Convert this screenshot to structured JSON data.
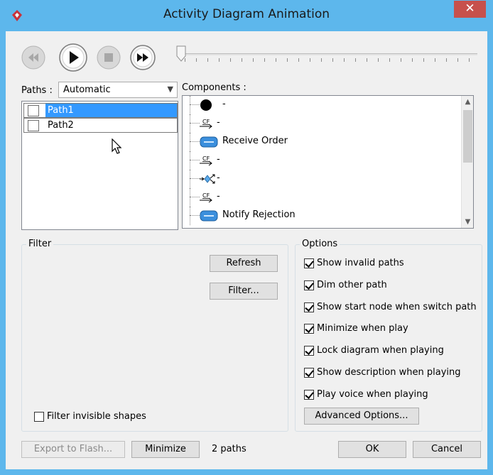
{
  "window": {
    "title": "Activity Diagram Animation",
    "close_label": "✕"
  },
  "paths": {
    "label": "Paths :",
    "selected_option": "Automatic",
    "items": [
      {
        "label": "Path1",
        "checked": false,
        "selected": true
      },
      {
        "label": "Path2",
        "checked": false,
        "selected": false
      }
    ]
  },
  "components": {
    "label": "Components :",
    "items": [
      {
        "icon": "initial-node-icon",
        "label": "-"
      },
      {
        "icon": "control-flow-icon",
        "label": "-"
      },
      {
        "icon": "action-icon",
        "label": "Receive Order"
      },
      {
        "icon": "control-flow-icon",
        "label": "-"
      },
      {
        "icon": "decision-node-icon",
        "label": "-"
      },
      {
        "icon": "control-flow-icon",
        "label": "-"
      },
      {
        "icon": "action-icon",
        "label": "Notify Rejection"
      }
    ],
    "flow_icon_text": "CF"
  },
  "filter": {
    "title": "Filter",
    "refresh_label": "Refresh",
    "filter_label": "Filter...",
    "invisible_shapes_label": "Filter invisible shapes",
    "invisible_shapes_checked": false
  },
  "options": {
    "title": "Options",
    "items": [
      {
        "label": "Show invalid paths",
        "checked": true
      },
      {
        "label": "Dim other path",
        "checked": true
      },
      {
        "label": "Show start node when switch path",
        "checked": true
      },
      {
        "label": "Minimize when play",
        "checked": true
      },
      {
        "label": "Lock diagram when playing",
        "checked": true
      },
      {
        "label": "Show description when playing",
        "checked": true
      },
      {
        "label": "Play voice when playing",
        "checked": true
      }
    ],
    "advanced_label": "Advanced Options..."
  },
  "footer": {
    "export_label": "Export to Flash...",
    "minimize_label": "Minimize",
    "status": "2 paths",
    "ok_label": "OK",
    "cancel_label": "Cancel"
  },
  "colors": {
    "titlebar": "#5db7ec",
    "selection": "#3399ff",
    "close": "#c7504c"
  }
}
